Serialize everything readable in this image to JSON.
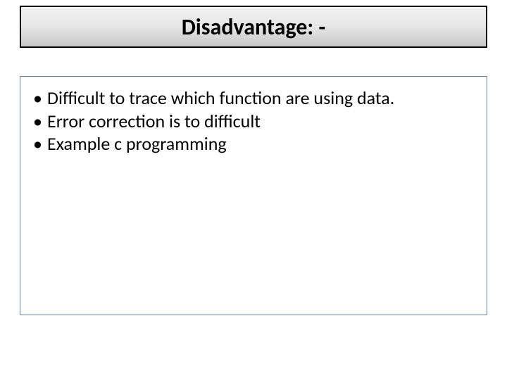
{
  "title": "Disadvantage: -",
  "bullets": [
    "Difficult to trace which function are using data.",
    "Error correction is to difficult",
    "Example c programming"
  ]
}
